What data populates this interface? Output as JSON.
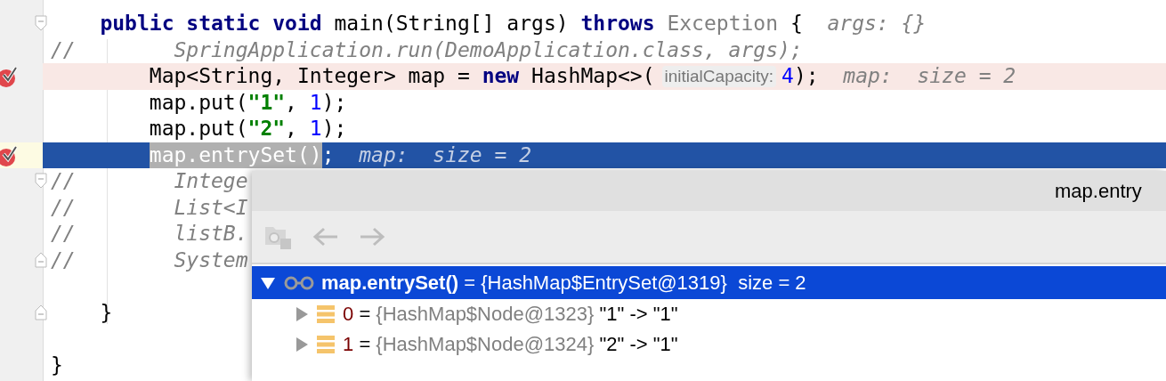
{
  "editor": {
    "lines": [
      {
        "breakpoint": false,
        "current": false,
        "fold_start": true,
        "fold_end": false,
        "segments": [
          {
            "kind": "keyword",
            "text": "    public static void"
          },
          {
            "kind": "plain",
            "text": " main(String[] args) "
          },
          {
            "kind": "keyword",
            "text": "throws"
          },
          {
            "kind": "type",
            "text": " Exception"
          },
          {
            "kind": "plain",
            "text": " {"
          },
          {
            "kind": "inline-value",
            "text": "  args: {}"
          }
        ]
      },
      {
        "breakpoint": false,
        "current": false,
        "fold_start": false,
        "fold_end": false,
        "segments": [
          {
            "kind": "comment",
            "text": "//"
          },
          {
            "kind": "comment",
            "text": "        SpringApplication.run(DemoApplication.class, args);"
          }
        ]
      },
      {
        "breakpoint": true,
        "current": false,
        "fold_start": false,
        "fold_end": false,
        "segments": [
          {
            "kind": "plain",
            "text": "        Map<String, Integer> map = "
          },
          {
            "kind": "keyword",
            "text": "new"
          },
          {
            "kind": "plain",
            "text": " HashMap<>("
          },
          {
            "kind": "param-hint",
            "text": "initialCapacity:"
          },
          {
            "kind": "number",
            "text": "4"
          },
          {
            "kind": "plain",
            "text": ");"
          },
          {
            "kind": "inline-value",
            "text": "  map:  size = 2"
          }
        ]
      },
      {
        "breakpoint": false,
        "current": false,
        "fold_start": false,
        "fold_end": false,
        "segments": [
          {
            "kind": "plain",
            "text": "        map.put("
          },
          {
            "kind": "string",
            "text": "\"1\""
          },
          {
            "kind": "plain",
            "text": ", "
          },
          {
            "kind": "number",
            "text": "1"
          },
          {
            "kind": "plain",
            "text": ");"
          }
        ]
      },
      {
        "breakpoint": false,
        "current": false,
        "fold_start": false,
        "fold_end": false,
        "segments": [
          {
            "kind": "plain",
            "text": "        map.put("
          },
          {
            "kind": "string",
            "text": "\"2\""
          },
          {
            "kind": "plain",
            "text": ", "
          },
          {
            "kind": "number",
            "text": "1"
          },
          {
            "kind": "plain",
            "text": ");"
          }
        ]
      },
      {
        "breakpoint": true,
        "current": true,
        "fold_start": false,
        "fold_end": false,
        "segments": [
          {
            "kind": "selection",
            "text": "        map.entrySet()"
          },
          {
            "kind": "plain",
            "text": ";"
          },
          {
            "kind": "inline-value",
            "text": "  map:  size = 2"
          }
        ]
      },
      {
        "breakpoint": false,
        "current": false,
        "fold_start": true,
        "fold_end": false,
        "segments": [
          {
            "kind": "comment",
            "text": "//"
          },
          {
            "kind": "comment",
            "text": "        Intege"
          }
        ]
      },
      {
        "breakpoint": false,
        "current": false,
        "fold_start": false,
        "fold_end": false,
        "segments": [
          {
            "kind": "comment",
            "text": "//"
          },
          {
            "kind": "comment",
            "text": "        List<I"
          }
        ]
      },
      {
        "breakpoint": false,
        "current": false,
        "fold_start": false,
        "fold_end": false,
        "segments": [
          {
            "kind": "comment",
            "text": "//"
          },
          {
            "kind": "comment",
            "text": "        listB."
          }
        ]
      },
      {
        "breakpoint": false,
        "current": false,
        "fold_start": false,
        "fold_end": true,
        "segments": [
          {
            "kind": "comment",
            "text": "//"
          },
          {
            "kind": "comment",
            "text": "        System"
          }
        ]
      },
      {
        "breakpoint": false,
        "current": false,
        "fold_start": false,
        "fold_end": false
      },
      {
        "breakpoint": false,
        "current": false,
        "fold_start": false,
        "fold_end": true,
        "segments": [
          {
            "kind": "plain",
            "text": "    }"
          }
        ]
      },
      {
        "breakpoint": false,
        "current": false,
        "fold_start": false,
        "fold_end": false
      },
      {
        "breakpoint": false,
        "current": false,
        "fold_start": false,
        "fold_end": false,
        "segments": [
          {
            "kind": "plain",
            "text": "}"
          }
        ]
      }
    ]
  },
  "popup": {
    "title": "map.entry",
    "tree": [
      {
        "kind": "watch",
        "name": "map.entrySet()",
        "operator": "=",
        "value": "{HashMap$EntrySet@1319}",
        "extra": "size = 2",
        "selected": true,
        "expanded": true,
        "children": [
          {
            "kind": "entry",
            "name": "0",
            "operator": "=",
            "value": "{HashMap$Node@1323}",
            "extra": "\"1\" -> \"1\"",
            "selected": false,
            "expanded": false
          },
          {
            "kind": "entry",
            "name": "1",
            "operator": "=",
            "value": "{HashMap$Node@1324}",
            "extra": "\"2\" -> \"1\"",
            "selected": false,
            "expanded": false
          }
        ]
      }
    ]
  }
}
